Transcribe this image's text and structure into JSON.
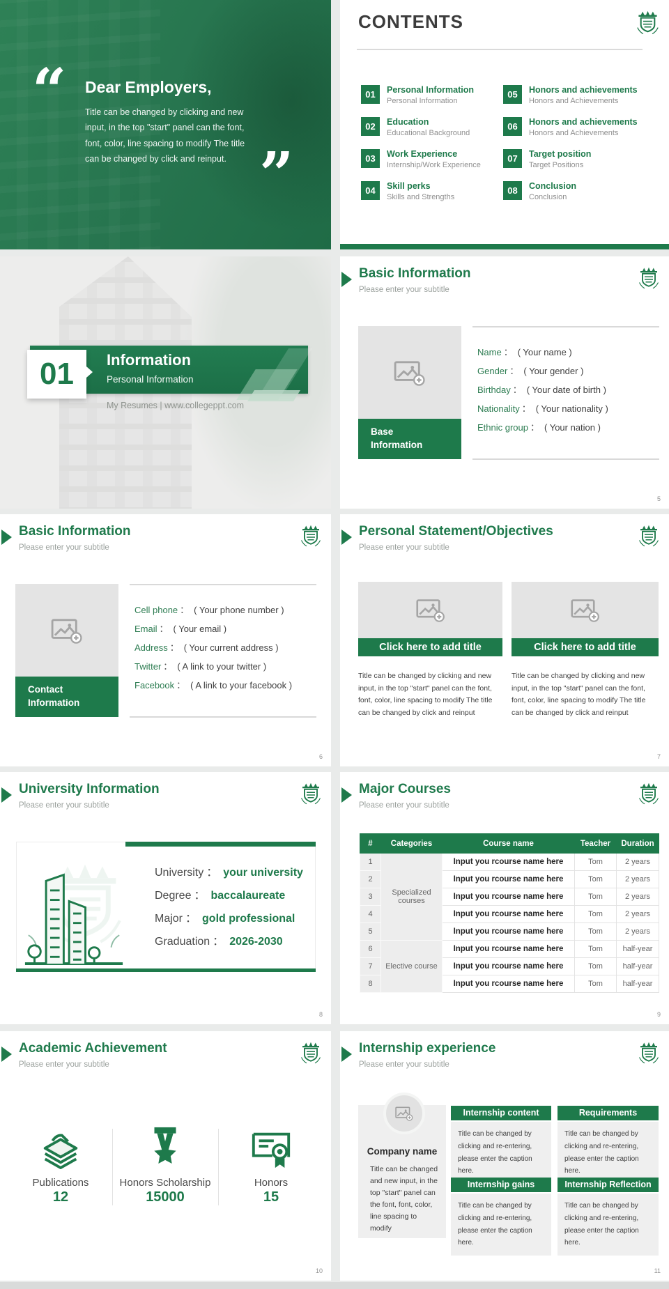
{
  "punct": {
    "colon": "："
  },
  "colors": {
    "green": "#1e7a4b",
    "green_heading": "#1f7a4c",
    "page_bg": "#e9ebea",
    "placeholder_gray": "#e4e4e4",
    "text_dark": "#3f3f3f",
    "text_gray": "#9ba19d"
  },
  "slide_quote": {
    "open_quote": "“",
    "close_quote": "”",
    "title": "Dear Employers,",
    "body": "Title can be changed by clicking and new input, in the top \"start\" panel can the font, font, color, line spacing to modify The title can be changed by click and reinput."
  },
  "slide_contents": {
    "title": "CONTENTS",
    "items": [
      {
        "num": "01",
        "label": "Personal Information",
        "sub": "Personal Information"
      },
      {
        "num": "02",
        "label": "Education",
        "sub": "Educational Background"
      },
      {
        "num": "03",
        "label": "Work Experience",
        "sub": "Internship/Work Experience"
      },
      {
        "num": "04",
        "label": "Skill perks",
        "sub": "Skills and Strengths"
      },
      {
        "num": "05",
        "label": "Honors and achievements",
        "sub": "Honors and Achievements"
      },
      {
        "num": "06",
        "label": "Honors and achievements",
        "sub": "Honors and Achievements"
      },
      {
        "num": "07",
        "label": "Target position",
        "sub": "Target Positions"
      },
      {
        "num": "08",
        "label": "Conclusion",
        "sub": "Conclusion"
      }
    ]
  },
  "slide_section": {
    "number": "01",
    "title": "Information",
    "subtitle": "Personal Information",
    "tagline": "My Resumes | www.collegeppt.com"
  },
  "slide_base_info": {
    "title": "Basic Information",
    "subtitle": "Please enter your subtitle",
    "card_label": "Base Information",
    "fields": [
      {
        "label": "Name",
        "value": "( Your name )"
      },
      {
        "label": "Gender",
        "value": "( Your gender )"
      },
      {
        "label": "Birthday",
        "value": "( Your date of birth )"
      },
      {
        "label": "Nationality",
        "value": "( Your nationality )"
      },
      {
        "label": "Ethnic group",
        "value": "( Your nation )"
      }
    ],
    "page": "5"
  },
  "slide_contact": {
    "title": "Basic Information",
    "subtitle": "Please enter your subtitle",
    "card_label": "Contact Information",
    "fields": [
      {
        "label": "Cell phone",
        "value": "( Your phone number )"
      },
      {
        "label": "Email",
        "value": "( Your email )"
      },
      {
        "label": "Address",
        "value": "( Your current address )"
      },
      {
        "label": "Twitter",
        "value": "( A link to your twitter )"
      },
      {
        "label": "Facebook",
        "value": "( A link to your facebook )"
      }
    ],
    "page": "6"
  },
  "slide_statement": {
    "title": "Personal Statement/Objectives",
    "subtitle": "Please enter your subtitle",
    "blocks": [
      {
        "bar": "Click here to add title",
        "body": "Title can be changed by clicking and new input, in the top \"start\" panel can the font, font, color, line spacing to modify The title can be changed by click and reinput"
      },
      {
        "bar": "Click here to add title",
        "body": "Title can be changed by clicking and new input, in the top \"start\" panel can the font, font, color, line spacing to modify The title can be changed by click and reinput"
      }
    ],
    "page": "7"
  },
  "slide_university": {
    "title": "University Information",
    "subtitle": "Please enter your subtitle",
    "fields": [
      {
        "label": "University",
        "value": "your university"
      },
      {
        "label": "Degree",
        "value": "baccalaureate"
      },
      {
        "label": "Major",
        "value": "gold professional"
      },
      {
        "label": "Graduation",
        "value": "2026-2030"
      }
    ],
    "page": "8"
  },
  "slide_courses": {
    "title": "Major Courses",
    "subtitle": "Please enter your subtitle",
    "headers": [
      "#",
      "Categories",
      "Course name",
      "Teacher",
      "Duration"
    ],
    "category_groups": [
      {
        "label": "Specialized courses"
      },
      {
        "label": "Elective course"
      }
    ],
    "rows": [
      {
        "num": "1",
        "course": "Input you rcourse name here",
        "teacher": "Tom",
        "duration": "2 years"
      },
      {
        "num": "2",
        "course": "Input you rcourse name here",
        "teacher": "Tom",
        "duration": "2 years"
      },
      {
        "num": "3",
        "course": "Input you rcourse name here",
        "teacher": "Tom",
        "duration": "2 years"
      },
      {
        "num": "4",
        "course": "Input you rcourse name here",
        "teacher": "Tom",
        "duration": "2 years"
      },
      {
        "num": "5",
        "course": "Input you rcourse name here",
        "teacher": "Tom",
        "duration": "2 years"
      },
      {
        "num": "6",
        "course": "Input you rcourse name here",
        "teacher": "Tom",
        "duration": "half-year"
      },
      {
        "num": "7",
        "course": "Input you rcourse name here",
        "teacher": "Tom",
        "duration": "half-year"
      },
      {
        "num": "8",
        "course": "Input you rcourse name here",
        "teacher": "Tom",
        "duration": "half-year"
      }
    ],
    "page": "9"
  },
  "slide_achievement": {
    "title": "Academic Achievement",
    "subtitle": "Please enter your subtitle",
    "items": [
      {
        "icon": "publications-icon",
        "label": "Publications",
        "value": "12"
      },
      {
        "icon": "medal-icon",
        "label": "Honors Scholarship",
        "value": "15000"
      },
      {
        "icon": "certificate-icon",
        "label": "Honors",
        "value": "15"
      }
    ],
    "page": "10"
  },
  "slide_internship": {
    "title": "Internship experience",
    "subtitle": "Please enter your subtitle",
    "company": {
      "name": "Company name",
      "body": "Title can be changed and new input, in the top \"start\" panel can the font, font, color, line spacing to modify"
    },
    "blocks": [
      {
        "header": "Internship content",
        "body": "Title can be changed by clicking and re-entering, please enter the caption here."
      },
      {
        "header": "Requirements",
        "body": "Title can be changed by clicking and re-entering, please enter the caption here."
      },
      {
        "header": "Internship gains",
        "body": "Title can be changed by clicking and re-entering, please enter the caption here."
      },
      {
        "header": "Internship Reflection",
        "body": "Title can be changed by clicking and re-entering, please enter the caption here."
      }
    ],
    "page": "11"
  }
}
